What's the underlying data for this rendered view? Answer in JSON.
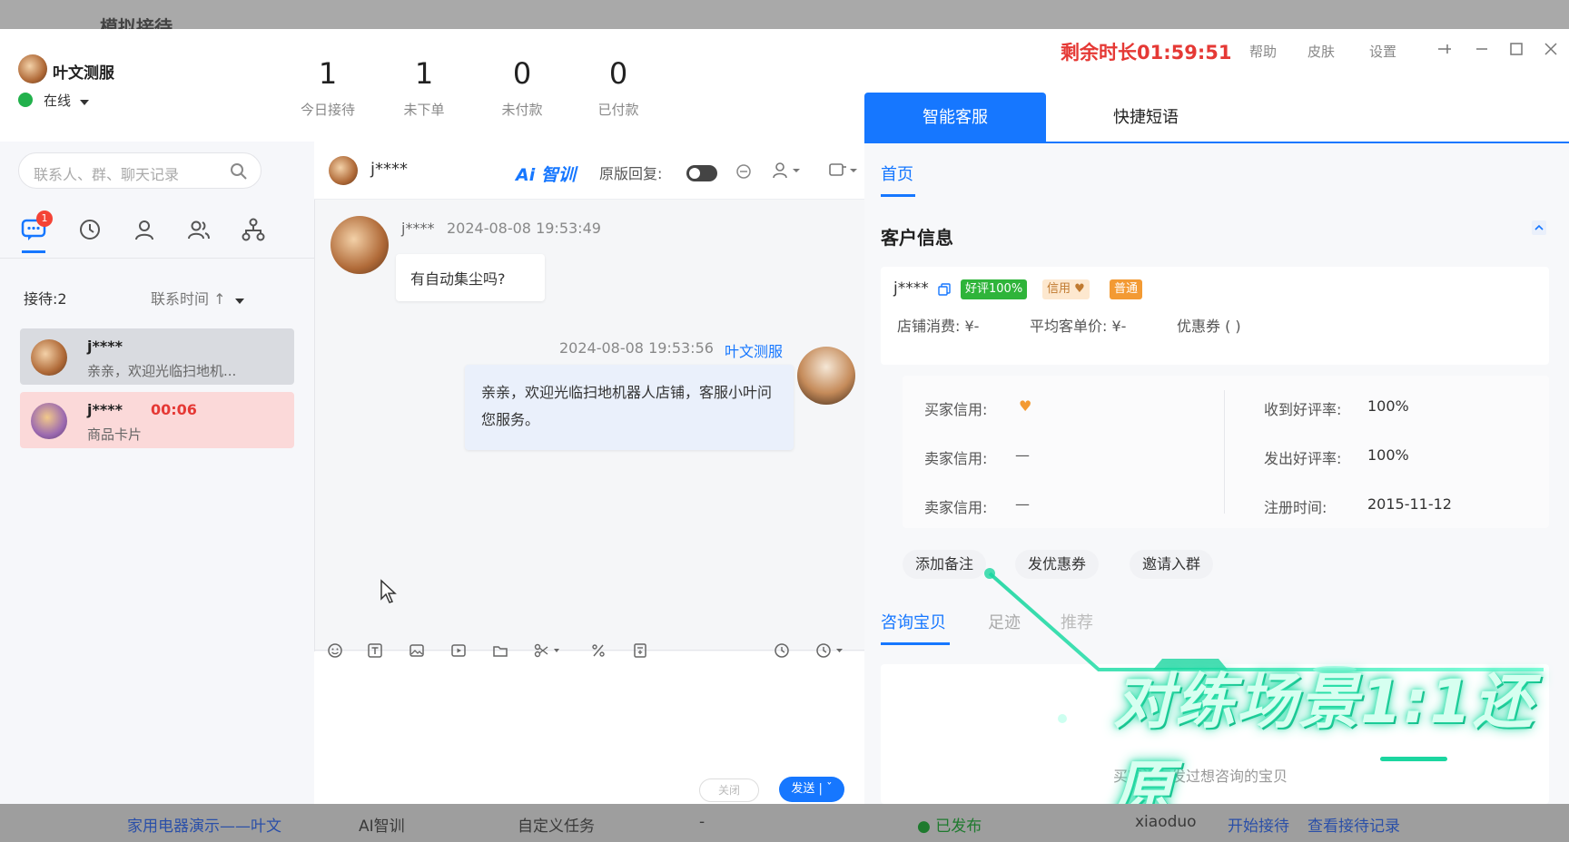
{
  "background": {
    "top_title": "模拟接待",
    "bottom_row": [
      "家用电器演示——叶文",
      "AI智训",
      "自定义任务",
      "-",
      "● 已发布",
      "xiaoduo",
      "开始接待",
      "查看接待记录"
    ]
  },
  "app": {
    "timer": "剩余时长01:59:51",
    "header_links": [
      "帮助",
      "皮肤",
      "设置"
    ],
    "accent": "#1677ff",
    "alert_color": "#e53935"
  },
  "profile": {
    "name": "叶文测服",
    "status": "在线"
  },
  "stats": [
    {
      "value": "1",
      "label": "今日接待"
    },
    {
      "value": "1",
      "label": "未下单"
    },
    {
      "value": "0",
      "label": "未付款"
    },
    {
      "value": "0",
      "label": "已付款"
    }
  ],
  "sidebar": {
    "search_placeholder": "联系人、群、聊天记录",
    "unread_badge": "1",
    "nav_icons": [
      "chat-icon",
      "clock-icon",
      "user-icon",
      "group-icon",
      "org-icon"
    ],
    "reception_count": "接待:2",
    "sort_label": "联系时间 ↑",
    "conversations": [
      {
        "name": "j****",
        "message": "亲亲，欢迎光临扫地机...",
        "timer": ""
      },
      {
        "name": "j****",
        "message": "商品卡片",
        "timer": "00:06"
      }
    ]
  },
  "chat": {
    "contact_name": "j****",
    "ai_label": "Ai 智训",
    "original_reply_label": "原版回复:",
    "messages": [
      {
        "from": "customer",
        "name": "j****",
        "time": "2024-08-08 19:53:49",
        "text": "有自动集尘吗?"
      },
      {
        "from": "agent",
        "name": "叶文测服",
        "time": "2024-08-08 19:53:56",
        "text": "亲亲，欢迎光临扫地机器人店铺，客服小叶问您服务。"
      }
    ],
    "close_label": "关闭",
    "send_label": "发送 | ˇ"
  },
  "right": {
    "tabs": [
      "智能客服",
      "快捷短语"
    ],
    "home_tab": "首页",
    "section_title": "客户信息",
    "customer": {
      "name": "j****",
      "tags": [
        "好评100%",
        "信用 ♥",
        "普通"
      ],
      "shop_spend": "店铺消费: ¥-",
      "avg_price": "平均客单价: ¥-",
      "coupon": "优惠券 ( )"
    },
    "credit": [
      {
        "label": "买家信用:",
        "value": "♥"
      },
      {
        "label": "卖家信用:",
        "value": "—"
      },
      {
        "label": "卖家信用:",
        "value": "—"
      }
    ],
    "rates": [
      {
        "label": "收到好评率:",
        "value": "100%"
      },
      {
        "label": "发出好评率:",
        "value": "100%"
      },
      {
        "label": "注册时间:",
        "value": "2015-11-12"
      }
    ],
    "actions": [
      "添加备注",
      "发优惠券",
      "邀请入群"
    ],
    "sub_tabs": [
      "咨询宝贝",
      "足迹",
      "推荐"
    ],
    "empty_note": "买家没有发过想咨询的宝贝",
    "overlay_caption": "对练场景1:1还原"
  }
}
